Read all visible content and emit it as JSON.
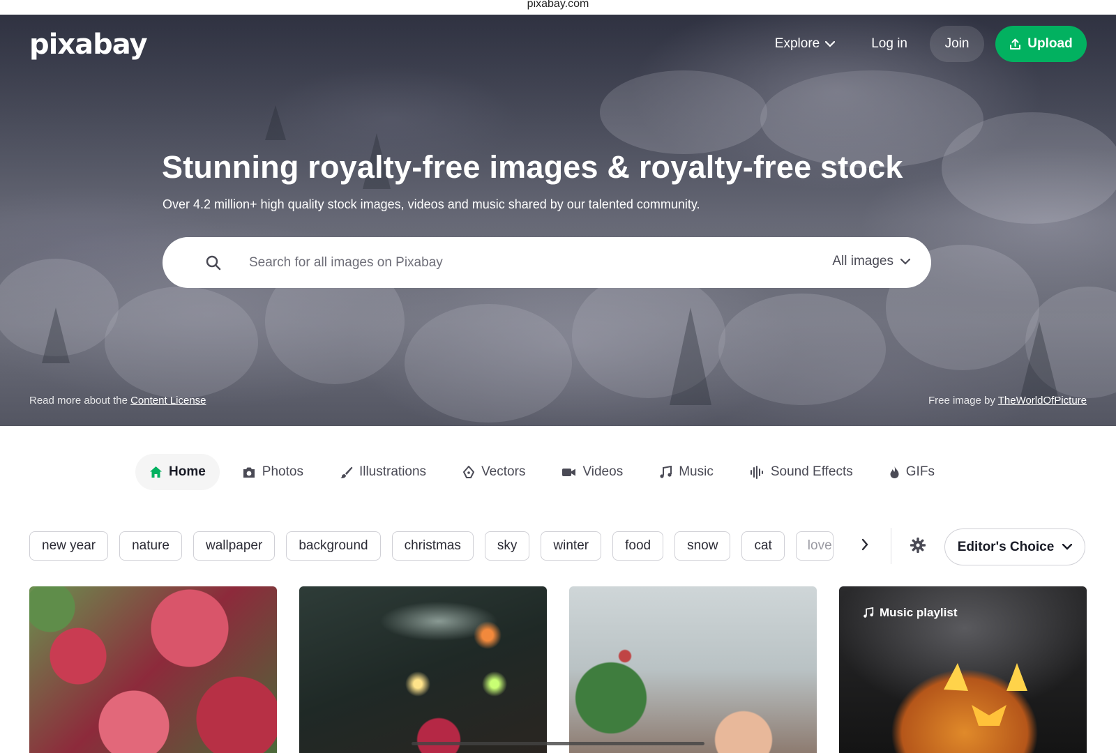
{
  "browser": {
    "url": "pixabay.com"
  },
  "header": {
    "logo": "pixabay",
    "nav": {
      "explore": "Explore",
      "login": "Log in",
      "join": "Join",
      "upload": "Upload"
    }
  },
  "hero": {
    "title": "Stunning royalty-free images & royalty-free stock",
    "subtitle": "Over 4.2 million+ high quality stock images, videos and music shared by our talented community.",
    "search": {
      "placeholder": "Search for all images on Pixabay",
      "value": "",
      "type_label": "All images"
    },
    "license_prefix": "Read more about the ",
    "license_link": "Content License",
    "credit_prefix": "Free image by ",
    "credit_link": "TheWorldOfPicture"
  },
  "tabs": [
    {
      "label": "Home",
      "icon": "home-icon",
      "active": true
    },
    {
      "label": "Photos",
      "icon": "camera-icon"
    },
    {
      "label": "Illustrations",
      "icon": "brush-icon"
    },
    {
      "label": "Vectors",
      "icon": "pen-nib-icon"
    },
    {
      "label": "Videos",
      "icon": "video-camera-icon"
    },
    {
      "label": "Music",
      "icon": "music-note-icon"
    },
    {
      "label": "Sound Effects",
      "icon": "waveform-icon"
    },
    {
      "label": "GIFs",
      "icon": "flame-icon"
    }
  ],
  "chips": [
    "new year",
    "nature",
    "wallpaper",
    "background",
    "christmas",
    "sky",
    "winter",
    "food",
    "snow",
    "cat",
    "love"
  ],
  "sort": {
    "label": "Editor's Choice"
  },
  "cards": [
    {
      "kind": "photo"
    },
    {
      "kind": "photo"
    },
    {
      "kind": "photo"
    },
    {
      "kind": "music",
      "badge": "Music playlist"
    }
  ],
  "colors": {
    "accent": "#02b160",
    "text": "#191b26"
  }
}
